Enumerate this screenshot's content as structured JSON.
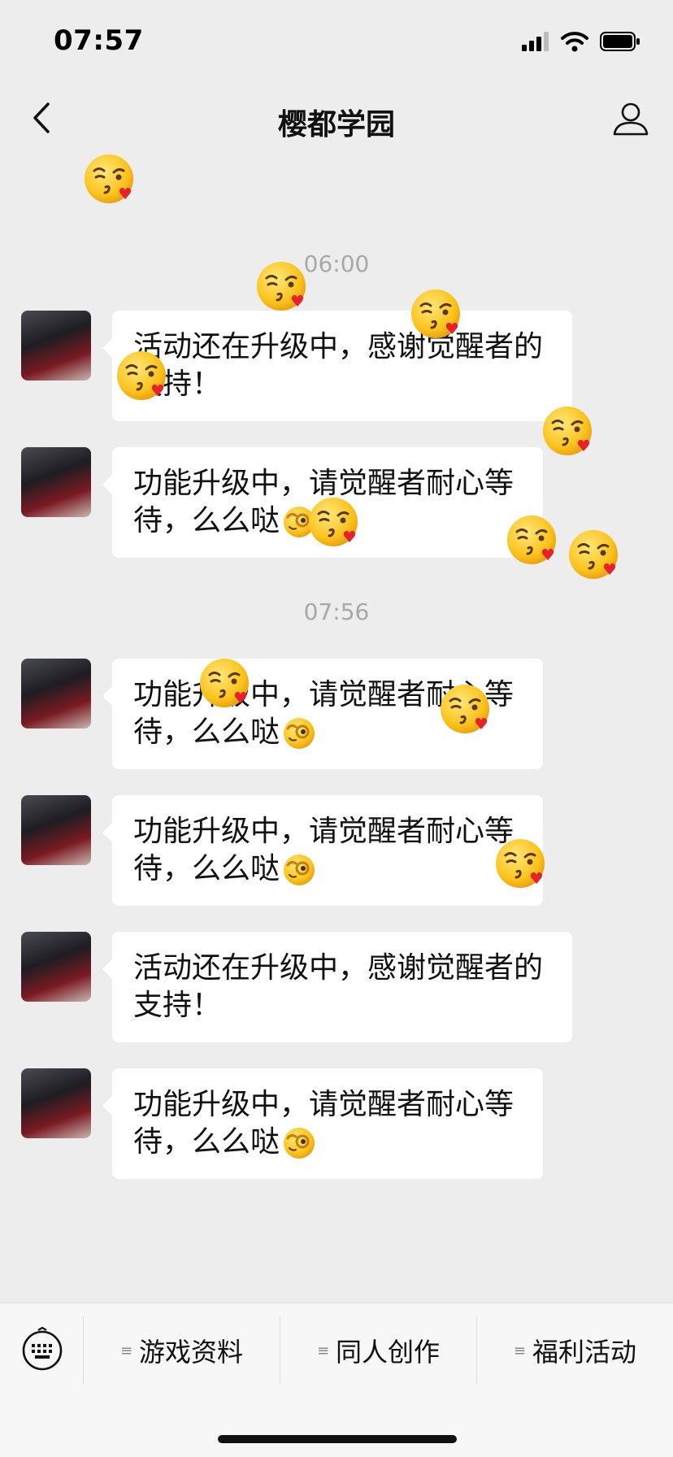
{
  "status_bar": {
    "time": "07:57",
    "icons": [
      "cellular-signal-icon",
      "wifi-icon",
      "battery-icon"
    ]
  },
  "nav": {
    "title": "樱都学园",
    "back_icon": "chevron-left-icon",
    "profile_icon": "person-icon"
  },
  "messages": {
    "time_1": "06:00",
    "time_2": "07:56",
    "m1": {
      "line1": "活动还在升级中，感谢觉醒者的",
      "line2": "支持！"
    },
    "m2": {
      "line1": "功能升级中，请觉醒者耐心等",
      "line2": "待，么么哒"
    },
    "m3": {
      "line1": "功能升级中，请觉醒者耐心等",
      "line2": "待，么么哒"
    },
    "m4": {
      "line1": "功能升级中，请觉醒者耐心等",
      "line2": "待，么么哒"
    },
    "m5": {
      "line1": "活动还在升级中，感谢觉醒者的",
      "line2": "支持！"
    },
    "m6": {
      "line1": "功能升级中，请觉醒者耐心等",
      "line2": "待，么么哒"
    }
  },
  "bottom_menu": {
    "keyboard_icon": "keyboard-icon",
    "items": [
      {
        "mark": "≡",
        "label": "游戏资料"
      },
      {
        "mark": "≡",
        "label": "同人创作"
      },
      {
        "mark": "≡",
        "label": "福利活动"
      }
    ]
  },
  "colors": {
    "background": "#ededed",
    "bubble": "#ffffff",
    "timestamp": "#a8a8a8",
    "menu_bg": "#f7f7f7"
  },
  "emoji_overlay": "face-blowing-kiss-icon"
}
